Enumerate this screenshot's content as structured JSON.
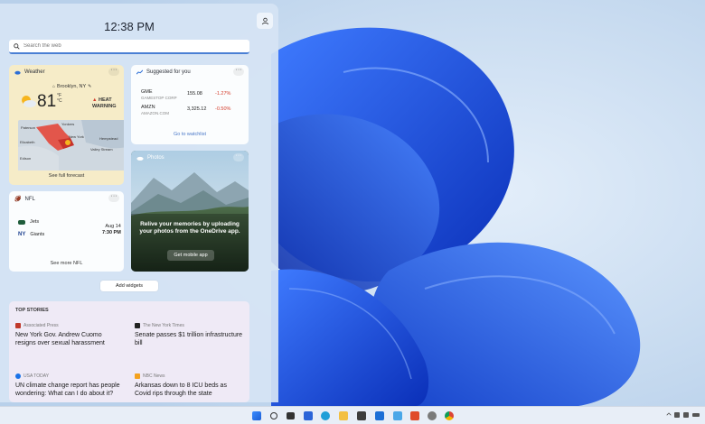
{
  "panel": {
    "time": "12:38 PM",
    "search_placeholder": "Search the web"
  },
  "weather": {
    "title": "Weather",
    "location": "Brooklyn, NY",
    "temperature": "81",
    "unit_f": "°F",
    "unit_c": "°C",
    "alert": "HEAT WARNING",
    "map_labels": [
      "Paterson",
      "Yonkers",
      "New York",
      "Elizabeth",
      "Valley Stream",
      "Edison",
      "Hempstead"
    ],
    "link": "See full forecast"
  },
  "stocks": {
    "title": "Suggested for you",
    "items": [
      {
        "symbol": "GME",
        "name": "GAMESTOP CORP",
        "price": "155.08",
        "change": "-1.27%"
      },
      {
        "symbol": "AMZN",
        "name": "AMAZON.COM",
        "price": "3,325.12",
        "change": "-0.50%"
      }
    ],
    "link": "Go to watchlist",
    "negative_color": "#d43c2b"
  },
  "nfl": {
    "title": "NFL",
    "team1": "Jets",
    "team2": "Giants",
    "date": "Aug 14",
    "time": "7:30 PM",
    "link": "See more NFL"
  },
  "photos": {
    "title": "Photos",
    "message": "Relive your memories by uploading your photos from the OneDrive app.",
    "button": "Get mobile app"
  },
  "add_widgets": "Add widgets",
  "stories": {
    "title": "TOP STORIES",
    "items": [
      {
        "source": "Associated Press",
        "headline": "New York Gov. Andrew Cuomo resigns over sexual harassment",
        "logo_color": "#c0392b"
      },
      {
        "source": "The New York Times",
        "headline": "Senate passes $1 trillion infrastructure bill",
        "logo_color": "#222222"
      },
      {
        "source": "USA TODAY",
        "headline": "UN climate change report has people wondering: What can I do about it?",
        "logo_color": "#1a73e8"
      },
      {
        "source": "NBC News",
        "headline": "Arkansas down to 8 ICU beds as Covid rips through the state",
        "logo_color": "#f4a21f"
      }
    ]
  },
  "taskbar": {
    "icons": [
      "start-icon",
      "search-icon",
      "task-view-icon",
      "widgets-icon",
      "edge-icon",
      "file-explorer-icon",
      "store-icon",
      "mail-icon",
      "photos-icon",
      "office-icon",
      "settings-icon",
      "chrome-icon"
    ],
    "accent": "#2b64d8"
  }
}
